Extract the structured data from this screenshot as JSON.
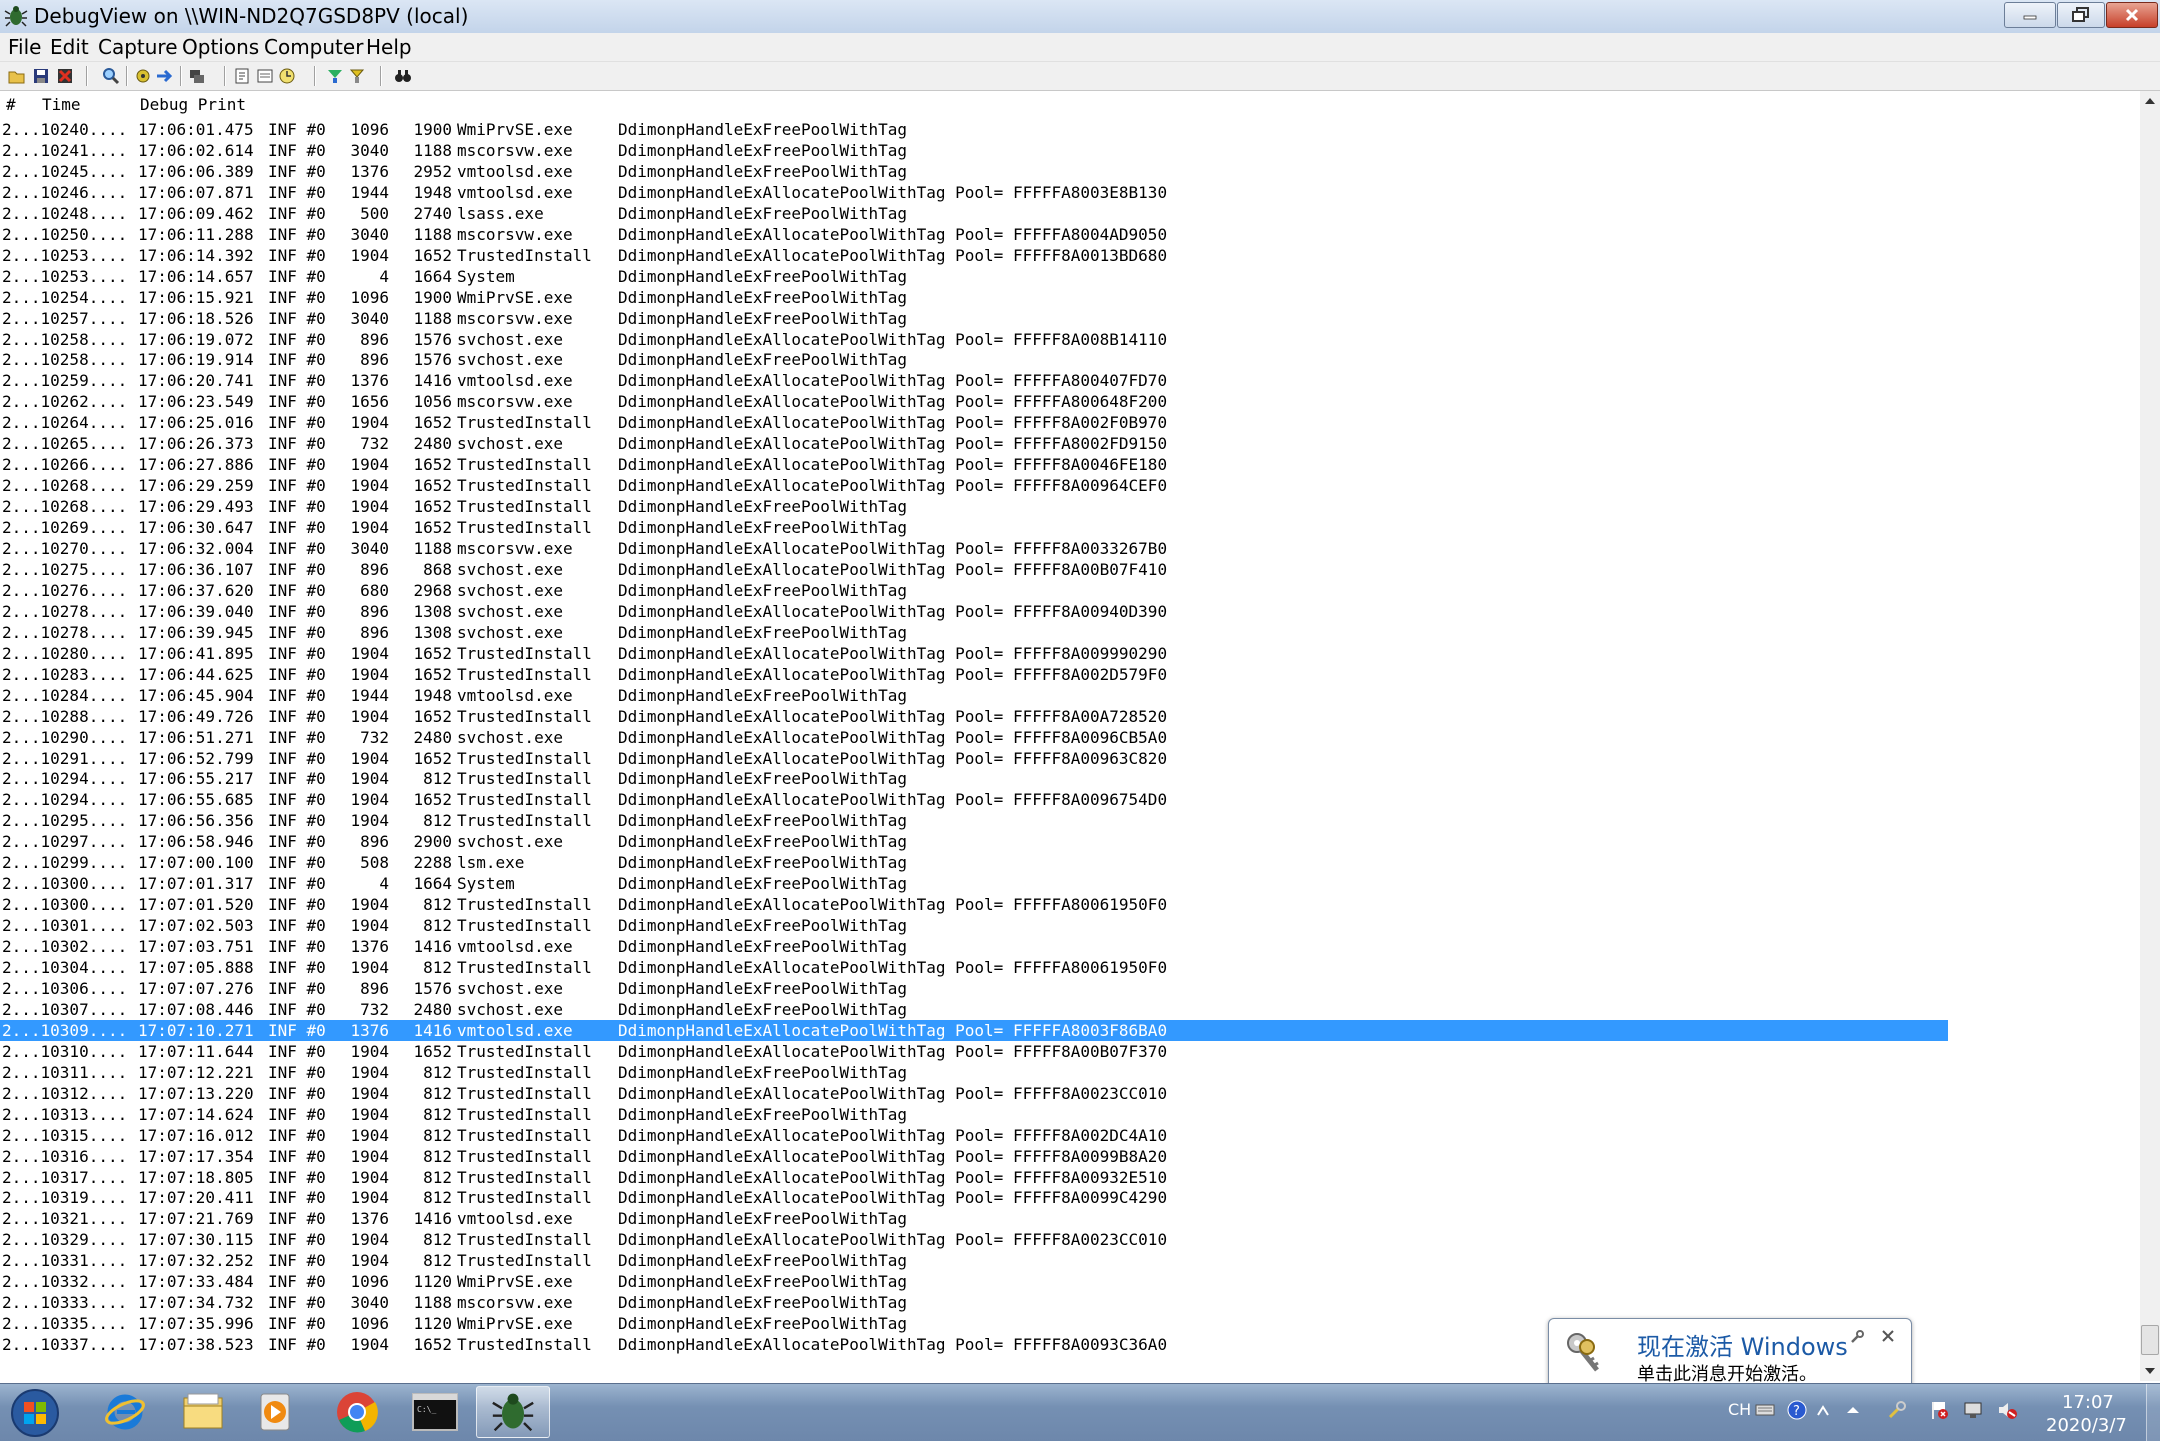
{
  "window": {
    "title": "DebugView on \\\\WIN-ND2Q7GSD8PV (local)"
  },
  "menu": [
    "File",
    "Edit",
    "Capture",
    "Options",
    "Computer",
    "Help"
  ],
  "toolbar_icons": [
    "open-icon",
    "save-icon",
    "clear-icon",
    "find-icon",
    "capture-icon",
    "autoscroll-icon",
    "connect-icon",
    "filter-icon",
    "history-icon",
    "clock-icon",
    "highlight-icon",
    "bookmark-icon",
    "search-binoculars-icon"
  ],
  "columns": {
    "num": "#",
    "time": "Time",
    "debug": "Debug Print"
  },
  "selected_index": 43,
  "rows": [
    {
      "idx": "2...10240....",
      "time": "17:06:01.475",
      "lvl": "INF #0",
      "pid": "1096",
      "tid": "1900",
      "proc": "WmiPrvSE.exe",
      "msg": "DdimonpHandleExFreePoolWithTag"
    },
    {
      "idx": "2...10241....",
      "time": "17:06:02.614",
      "lvl": "INF #0",
      "pid": "3040",
      "tid": "1188",
      "proc": "mscorsvw.exe",
      "msg": "DdimonpHandleExFreePoolWithTag"
    },
    {
      "idx": "2...10245....",
      "time": "17:06:06.389",
      "lvl": "INF #0",
      "pid": "1376",
      "tid": "2952",
      "proc": "vmtoolsd.exe",
      "msg": "DdimonpHandleExFreePoolWithTag"
    },
    {
      "idx": "2...10246....",
      "time": "17:06:07.871",
      "lvl": "INF #0",
      "pid": "1944",
      "tid": "1948",
      "proc": "vmtoolsd.exe",
      "msg": "DdimonpHandleExAllocatePoolWithTag Pool= FFFFFA8003E8B130"
    },
    {
      "idx": "2...10248....",
      "time": "17:06:09.462",
      "lvl": "INF #0",
      "pid": "500",
      "tid": "2740",
      "proc": "lsass.exe",
      "msg": "DdimonpHandleExFreePoolWithTag"
    },
    {
      "idx": "2...10250....",
      "time": "17:06:11.288",
      "lvl": "INF #0",
      "pid": "3040",
      "tid": "1188",
      "proc": "mscorsvw.exe",
      "msg": "DdimonpHandleExAllocatePoolWithTag Pool= FFFFFA8004AD9050"
    },
    {
      "idx": "2...10253....",
      "time": "17:06:14.392",
      "lvl": "INF #0",
      "pid": "1904",
      "tid": "1652",
      "proc": "TrustedInstall",
      "msg": "DdimonpHandleExAllocatePoolWithTag Pool= FFFFF8A0013BD680"
    },
    {
      "idx": "2...10253....",
      "time": "17:06:14.657",
      "lvl": "INF #0",
      "pid": "4",
      "tid": "1664",
      "proc": "System",
      "msg": "DdimonpHandleExFreePoolWithTag"
    },
    {
      "idx": "2...10254....",
      "time": "17:06:15.921",
      "lvl": "INF #0",
      "pid": "1096",
      "tid": "1900",
      "proc": "WmiPrvSE.exe",
      "msg": "DdimonpHandleExFreePoolWithTag"
    },
    {
      "idx": "2...10257....",
      "time": "17:06:18.526",
      "lvl": "INF #0",
      "pid": "3040",
      "tid": "1188",
      "proc": "mscorsvw.exe",
      "msg": "DdimonpHandleExFreePoolWithTag"
    },
    {
      "idx": "2...10258....",
      "time": "17:06:19.072",
      "lvl": "INF #0",
      "pid": "896",
      "tid": "1576",
      "proc": "svchost.exe",
      "msg": "DdimonpHandleExAllocatePoolWithTag Pool= FFFFF8A008B14110"
    },
    {
      "idx": "2...10258....",
      "time": "17:06:19.914",
      "lvl": "INF #0",
      "pid": "896",
      "tid": "1576",
      "proc": "svchost.exe",
      "msg": "DdimonpHandleExFreePoolWithTag"
    },
    {
      "idx": "2...10259....",
      "time": "17:06:20.741",
      "lvl": "INF #0",
      "pid": "1376",
      "tid": "1416",
      "proc": "vmtoolsd.exe",
      "msg": "DdimonpHandleExAllocatePoolWithTag Pool= FFFFFA800407FD70"
    },
    {
      "idx": "2...10262....",
      "time": "17:06:23.549",
      "lvl": "INF #0",
      "pid": "1656",
      "tid": "1056",
      "proc": "mscorsvw.exe",
      "msg": "DdimonpHandleExAllocatePoolWithTag Pool= FFFFFA800648F200"
    },
    {
      "idx": "2...10264....",
      "time": "17:06:25.016",
      "lvl": "INF #0",
      "pid": "1904",
      "tid": "1652",
      "proc": "TrustedInstall",
      "msg": "DdimonpHandleExAllocatePoolWithTag Pool= FFFFF8A002F0B970"
    },
    {
      "idx": "2...10265....",
      "time": "17:06:26.373",
      "lvl": "INF #0",
      "pid": "732",
      "tid": "2480",
      "proc": "svchost.exe",
      "msg": "DdimonpHandleExAllocatePoolWithTag Pool= FFFFFA8002FD9150"
    },
    {
      "idx": "2...10266....",
      "time": "17:06:27.886",
      "lvl": "INF #0",
      "pid": "1904",
      "tid": "1652",
      "proc": "TrustedInstall",
      "msg": "DdimonpHandleExAllocatePoolWithTag Pool= FFFFF8A0046FE180"
    },
    {
      "idx": "2...10268....",
      "time": "17:06:29.259",
      "lvl": "INF #0",
      "pid": "1904",
      "tid": "1652",
      "proc": "TrustedInstall",
      "msg": "DdimonpHandleExAllocatePoolWithTag Pool= FFFFF8A00964CEF0"
    },
    {
      "idx": "2...10268....",
      "time": "17:06:29.493",
      "lvl": "INF #0",
      "pid": "1904",
      "tid": "1652",
      "proc": "TrustedInstall",
      "msg": "DdimonpHandleExFreePoolWithTag"
    },
    {
      "idx": "2...10269....",
      "time": "17:06:30.647",
      "lvl": "INF #0",
      "pid": "1904",
      "tid": "1652",
      "proc": "TrustedInstall",
      "msg": "DdimonpHandleExFreePoolWithTag"
    },
    {
      "idx": "2...10270....",
      "time": "17:06:32.004",
      "lvl": "INF #0",
      "pid": "3040",
      "tid": "1188",
      "proc": "mscorsvw.exe",
      "msg": "DdimonpHandleExAllocatePoolWithTag Pool= FFFFF8A0033267B0"
    },
    {
      "idx": "2...10275....",
      "time": "17:06:36.107",
      "lvl": "INF #0",
      "pid": "896",
      "tid": "868",
      "proc": "svchost.exe",
      "msg": "DdimonpHandleExAllocatePoolWithTag Pool= FFFFF8A00B07F410"
    },
    {
      "idx": "2...10276....",
      "time": "17:06:37.620",
      "lvl": "INF #0",
      "pid": "680",
      "tid": "2968",
      "proc": "svchost.exe",
      "msg": "DdimonpHandleExFreePoolWithTag"
    },
    {
      "idx": "2...10278....",
      "time": "17:06:39.040",
      "lvl": "INF #0",
      "pid": "896",
      "tid": "1308",
      "proc": "svchost.exe",
      "msg": "DdimonpHandleExAllocatePoolWithTag Pool= FFFFF8A00940D390"
    },
    {
      "idx": "2...10278....",
      "time": "17:06:39.945",
      "lvl": "INF #0",
      "pid": "896",
      "tid": "1308",
      "proc": "svchost.exe",
      "msg": "DdimonpHandleExFreePoolWithTag"
    },
    {
      "idx": "2...10280....",
      "time": "17:06:41.895",
      "lvl": "INF #0",
      "pid": "1904",
      "tid": "1652",
      "proc": "TrustedInstall",
      "msg": "DdimonpHandleExAllocatePoolWithTag Pool= FFFFF8A009990290"
    },
    {
      "idx": "2...10283....",
      "time": "17:06:44.625",
      "lvl": "INF #0",
      "pid": "1904",
      "tid": "1652",
      "proc": "TrustedInstall",
      "msg": "DdimonpHandleExAllocatePoolWithTag Pool= FFFFF8A002D579F0"
    },
    {
      "idx": "2...10284....",
      "time": "17:06:45.904",
      "lvl": "INF #0",
      "pid": "1944",
      "tid": "1948",
      "proc": "vmtoolsd.exe",
      "msg": "DdimonpHandleExFreePoolWithTag"
    },
    {
      "idx": "2...10288....",
      "time": "17:06:49.726",
      "lvl": "INF #0",
      "pid": "1904",
      "tid": "1652",
      "proc": "TrustedInstall",
      "msg": "DdimonpHandleExAllocatePoolWithTag Pool= FFFFF8A00A728520"
    },
    {
      "idx": "2...10290....",
      "time": "17:06:51.271",
      "lvl": "INF #0",
      "pid": "732",
      "tid": "2480",
      "proc": "svchost.exe",
      "msg": "DdimonpHandleExAllocatePoolWithTag Pool= FFFFF8A0096CB5A0"
    },
    {
      "idx": "2...10291....",
      "time": "17:06:52.799",
      "lvl": "INF #0",
      "pid": "1904",
      "tid": "1652",
      "proc": "TrustedInstall",
      "msg": "DdimonpHandleExAllocatePoolWithTag Pool= FFFFF8A00963C820"
    },
    {
      "idx": "2...10294....",
      "time": "17:06:55.217",
      "lvl": "INF #0",
      "pid": "1904",
      "tid": "812",
      "proc": "TrustedInstall",
      "msg": "DdimonpHandleExFreePoolWithTag"
    },
    {
      "idx": "2...10294....",
      "time": "17:06:55.685",
      "lvl": "INF #0",
      "pid": "1904",
      "tid": "1652",
      "proc": "TrustedInstall",
      "msg": "DdimonpHandleExAllocatePoolWithTag Pool= FFFFF8A0096754D0"
    },
    {
      "idx": "2...10295....",
      "time": "17:06:56.356",
      "lvl": "INF #0",
      "pid": "1904",
      "tid": "812",
      "proc": "TrustedInstall",
      "msg": "DdimonpHandleExFreePoolWithTag"
    },
    {
      "idx": "2...10297....",
      "time": "17:06:58.946",
      "lvl": "INF #0",
      "pid": "896",
      "tid": "2900",
      "proc": "svchost.exe",
      "msg": "DdimonpHandleExFreePoolWithTag"
    },
    {
      "idx": "2...10299....",
      "time": "17:07:00.100",
      "lvl": "INF #0",
      "pid": "508",
      "tid": "2288",
      "proc": "lsm.exe",
      "msg": "DdimonpHandleExFreePoolWithTag"
    },
    {
      "idx": "2...10300....",
      "time": "17:07:01.317",
      "lvl": "INF #0",
      "pid": "4",
      "tid": "1664",
      "proc": "System",
      "msg": "DdimonpHandleExFreePoolWithTag"
    },
    {
      "idx": "2...10300....",
      "time": "17:07:01.520",
      "lvl": "INF #0",
      "pid": "1904",
      "tid": "812",
      "proc": "TrustedInstall",
      "msg": "DdimonpHandleExAllocatePoolWithTag Pool= FFFFFA80061950F0"
    },
    {
      "idx": "2...10301....",
      "time": "17:07:02.503",
      "lvl": "INF #0",
      "pid": "1904",
      "tid": "812",
      "proc": "TrustedInstall",
      "msg": "DdimonpHandleExFreePoolWithTag"
    },
    {
      "idx": "2...10302....",
      "time": "17:07:03.751",
      "lvl": "INF #0",
      "pid": "1376",
      "tid": "1416",
      "proc": "vmtoolsd.exe",
      "msg": "DdimonpHandleExFreePoolWithTag"
    },
    {
      "idx": "2...10304....",
      "time": "17:07:05.888",
      "lvl": "INF #0",
      "pid": "1904",
      "tid": "812",
      "proc": "TrustedInstall",
      "msg": "DdimonpHandleExAllocatePoolWithTag Pool= FFFFFA80061950F0"
    },
    {
      "idx": "2...10306....",
      "time": "17:07:07.276",
      "lvl": "INF #0",
      "pid": "896",
      "tid": "1576",
      "proc": "svchost.exe",
      "msg": "DdimonpHandleExFreePoolWithTag"
    },
    {
      "idx": "2...10307....",
      "time": "17:07:08.446",
      "lvl": "INF #0",
      "pid": "732",
      "tid": "2480",
      "proc": "svchost.exe",
      "msg": "DdimonpHandleExFreePoolWithTag"
    },
    {
      "idx": "2...10309....",
      "time": "17:07:10.271",
      "lvl": "INF #0",
      "pid": "1376",
      "tid": "1416",
      "proc": "vmtoolsd.exe",
      "msg": "DdimonpHandleExAllocatePoolWithTag Pool= FFFFFA8003F86BA0"
    },
    {
      "idx": "2...10310....",
      "time": "17:07:11.644",
      "lvl": "INF #0",
      "pid": "1904",
      "tid": "1652",
      "proc": "TrustedInstall",
      "msg": "DdimonpHandleExAllocatePoolWithTag Pool= FFFFF8A00B07F370"
    },
    {
      "idx": "2...10311....",
      "time": "17:07:12.221",
      "lvl": "INF #0",
      "pid": "1904",
      "tid": "812",
      "proc": "TrustedInstall",
      "msg": "DdimonpHandleExFreePoolWithTag"
    },
    {
      "idx": "2...10312....",
      "time": "17:07:13.220",
      "lvl": "INF #0",
      "pid": "1904",
      "tid": "812",
      "proc": "TrustedInstall",
      "msg": "DdimonpHandleExAllocatePoolWithTag Pool= FFFFF8A0023CC010"
    },
    {
      "idx": "2...10313....",
      "time": "17:07:14.624",
      "lvl": "INF #0",
      "pid": "1904",
      "tid": "812",
      "proc": "TrustedInstall",
      "msg": "DdimonpHandleExFreePoolWithTag"
    },
    {
      "idx": "2...10315....",
      "time": "17:07:16.012",
      "lvl": "INF #0",
      "pid": "1904",
      "tid": "812",
      "proc": "TrustedInstall",
      "msg": "DdimonpHandleExAllocatePoolWithTag Pool= FFFFF8A002DC4A10"
    },
    {
      "idx": "2...10316....",
      "time": "17:07:17.354",
      "lvl": "INF #0",
      "pid": "1904",
      "tid": "812",
      "proc": "TrustedInstall",
      "msg": "DdimonpHandleExAllocatePoolWithTag Pool= FFFFF8A0099B8A20"
    },
    {
      "idx": "2...10317....",
      "time": "17:07:18.805",
      "lvl": "INF #0",
      "pid": "1904",
      "tid": "812",
      "proc": "TrustedInstall",
      "msg": "DdimonpHandleExAllocatePoolWithTag Pool= FFFFF8A00932E510"
    },
    {
      "idx": "2...10319....",
      "time": "17:07:20.411",
      "lvl": "INF #0",
      "pid": "1904",
      "tid": "812",
      "proc": "TrustedInstall",
      "msg": "DdimonpHandleExAllocatePoolWithTag Pool= FFFFF8A0099C4290"
    },
    {
      "idx": "2...10321....",
      "time": "17:07:21.769",
      "lvl": "INF #0",
      "pid": "1376",
      "tid": "1416",
      "proc": "vmtoolsd.exe",
      "msg": "DdimonpHandleExFreePoolWithTag"
    },
    {
      "idx": "2...10329....",
      "time": "17:07:30.115",
      "lvl": "INF #0",
      "pid": "1904",
      "tid": "812",
      "proc": "TrustedInstall",
      "msg": "DdimonpHandleExAllocatePoolWithTag Pool= FFFFF8A0023CC010"
    },
    {
      "idx": "2...10331....",
      "time": "17:07:32.252",
      "lvl": "INF #0",
      "pid": "1904",
      "tid": "812",
      "proc": "TrustedInstall",
      "msg": "DdimonpHandleExFreePoolWithTag"
    },
    {
      "idx": "2...10332....",
      "time": "17:07:33.484",
      "lvl": "INF #0",
      "pid": "1096",
      "tid": "1120",
      "proc": "WmiPrvSE.exe",
      "msg": "DdimonpHandleExFreePoolWithTag"
    },
    {
      "idx": "2...10333....",
      "time": "17:07:34.732",
      "lvl": "INF #0",
      "pid": "3040",
      "tid": "1188",
      "proc": "mscorsvw.exe",
      "msg": "DdimonpHandleExFreePoolWithTag"
    },
    {
      "idx": "2...10335....",
      "time": "17:07:35.996",
      "lvl": "INF #0",
      "pid": "1096",
      "tid": "1120",
      "proc": "WmiPrvSE.exe",
      "msg": "DdimonpHandleExFreePoolWithTag"
    },
    {
      "idx": "2...10337....",
      "time": "17:07:38.523",
      "lvl": "INF #0",
      "pid": "1904",
      "tid": "1652",
      "proc": "TrustedInstall",
      "msg": "DdimonpHandleExAllocatePoolWithTag Pool= FFFFF8A0093C36A0"
    }
  ],
  "notification": {
    "title": "现在激活 Windows",
    "subtitle": "单击此消息开始激活。"
  },
  "taskbar": {
    "apps": [
      "internet-explorer-icon",
      "file-explorer-icon",
      "media-player-icon",
      "chrome-icon",
      "command-prompt-icon",
      "debugview-icon"
    ],
    "active_app": "debugview-icon",
    "lang": "CH",
    "time": "17:07",
    "date": "2020/3/7"
  },
  "colors": {
    "selection": "#3399ff",
    "notif_title": "#1c5aa6"
  }
}
